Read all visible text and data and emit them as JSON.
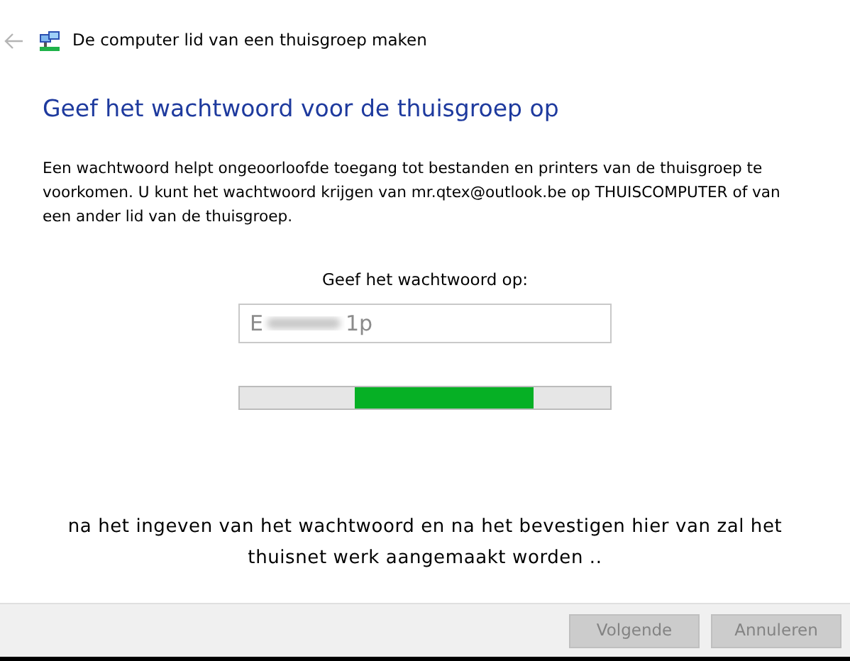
{
  "window": {
    "title": "De computer lid van een thuisgroep maken",
    "back_enabled": false
  },
  "heading": "Geef het wachtwoord voor de thuisgroep op",
  "description": "Een wachtwoord helpt ongeoorloofde toegang tot bestanden en printers van de thuisgroep te voorkomen. U kunt het wachtwoord krijgen van mr.qtex@outlook.be op THUISCOMPUTER of van een ander lid van de thuisgroep.",
  "password_label": "Geef het wachtwoord op:",
  "password_field": {
    "value_start": "E",
    "value_end": "1p",
    "blurred": true,
    "disabled": true
  },
  "progress": {
    "kind": "marquee"
  },
  "note": "na het ingeven van het wachtwoord en na het bevestigen hier van zal het thuisnet werk aangemaakt worden ..",
  "buttons": [
    {
      "label": "Volgende",
      "disabled": true
    },
    {
      "label": "Annuleren",
      "disabled": true
    }
  ]
}
